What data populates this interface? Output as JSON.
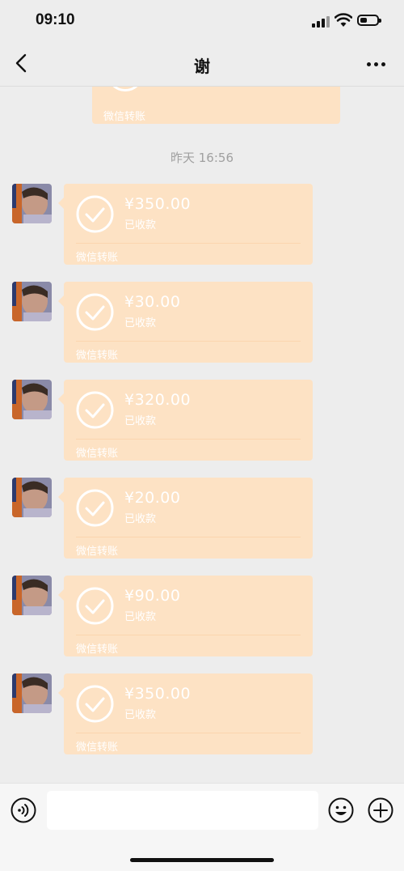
{
  "status_bar": {
    "time": "09:10"
  },
  "nav": {
    "title": "谢",
    "back_icon": "chevron-left-icon",
    "more_icon": "more-dots-icon"
  },
  "chat": {
    "partial_message": {
      "footer": "微信转账"
    },
    "timestamp": "昨天 16:56",
    "messages": [
      {
        "amount": "¥350.00",
        "status": "已收款",
        "footer": "微信转账"
      },
      {
        "amount": "¥30.00",
        "status": "已收款",
        "footer": "微信转账"
      },
      {
        "amount": "¥320.00",
        "status": "已收款",
        "footer": "微信转账"
      },
      {
        "amount": "¥20.00",
        "status": "已收款",
        "footer": "微信转账"
      },
      {
        "amount": "¥90.00",
        "status": "已收款",
        "footer": "微信转账"
      },
      {
        "amount": "¥350.00",
        "status": "已收款",
        "footer": "微信转账"
      }
    ]
  },
  "input_bar": {
    "placeholder": "",
    "icons": [
      "voice-icon",
      "emoji-icon",
      "plus-icon"
    ]
  },
  "colors": {
    "bubble": "#fde2c4",
    "background": "#ededed"
  }
}
